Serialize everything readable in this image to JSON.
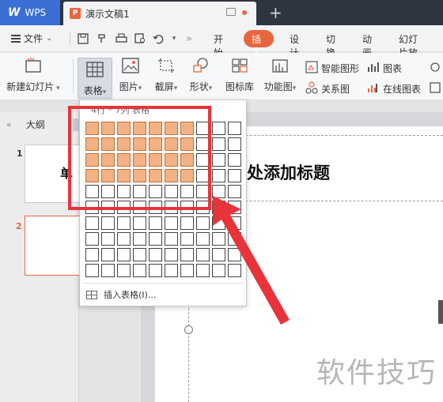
{
  "titlebar": {
    "app_logo": "W",
    "app_name": "WPS",
    "doc_icon": "P",
    "doc_title": "演示文稿1",
    "add_tab": "+"
  },
  "menubar": {
    "file_label": "文件",
    "file_arrow": "⌄",
    "quick_icons": [
      "save-icon",
      "undo-format-icon",
      "print-icon",
      "preview-icon",
      "undo-icon",
      "more-icon"
    ],
    "tabs": [
      "开始",
      "插入",
      "设计",
      "切换",
      "动画",
      "幻灯片放"
    ],
    "active_tab": "插入"
  },
  "ribbon": {
    "new_slide": "新建幻灯片",
    "table": "表格",
    "picture": "图片",
    "screenshot": "截屏",
    "shape": "形状",
    "icon_lib": "图标库",
    "function_chart": "功能图",
    "smart_graphic": "智能图形",
    "chart": "图表",
    "relation": "关系图",
    "online_chart": "在线图表"
  },
  "left_pane": {
    "collapse": "«",
    "outline_tab": "大纲",
    "slides": [
      {
        "number": "1",
        "preview_text": "单"
      },
      {
        "number": "2",
        "preview_text": ""
      }
    ]
  },
  "slide": {
    "title_placeholder": "处添加标题"
  },
  "table_dropdown": {
    "header": "4行 * 7列 表格",
    "grid": {
      "rows": 10,
      "cols": 10,
      "selected_rows": 4,
      "selected_cols": 7
    },
    "insert_label": "插入表格(I)...",
    "highlight_color": "#f4b183"
  },
  "annotation": {
    "color": "#e8333a"
  },
  "watermark": {
    "text": "软件技巧"
  },
  "colors": {
    "accent": "#e8663d",
    "wps_blue": "#3b6fd4"
  }
}
